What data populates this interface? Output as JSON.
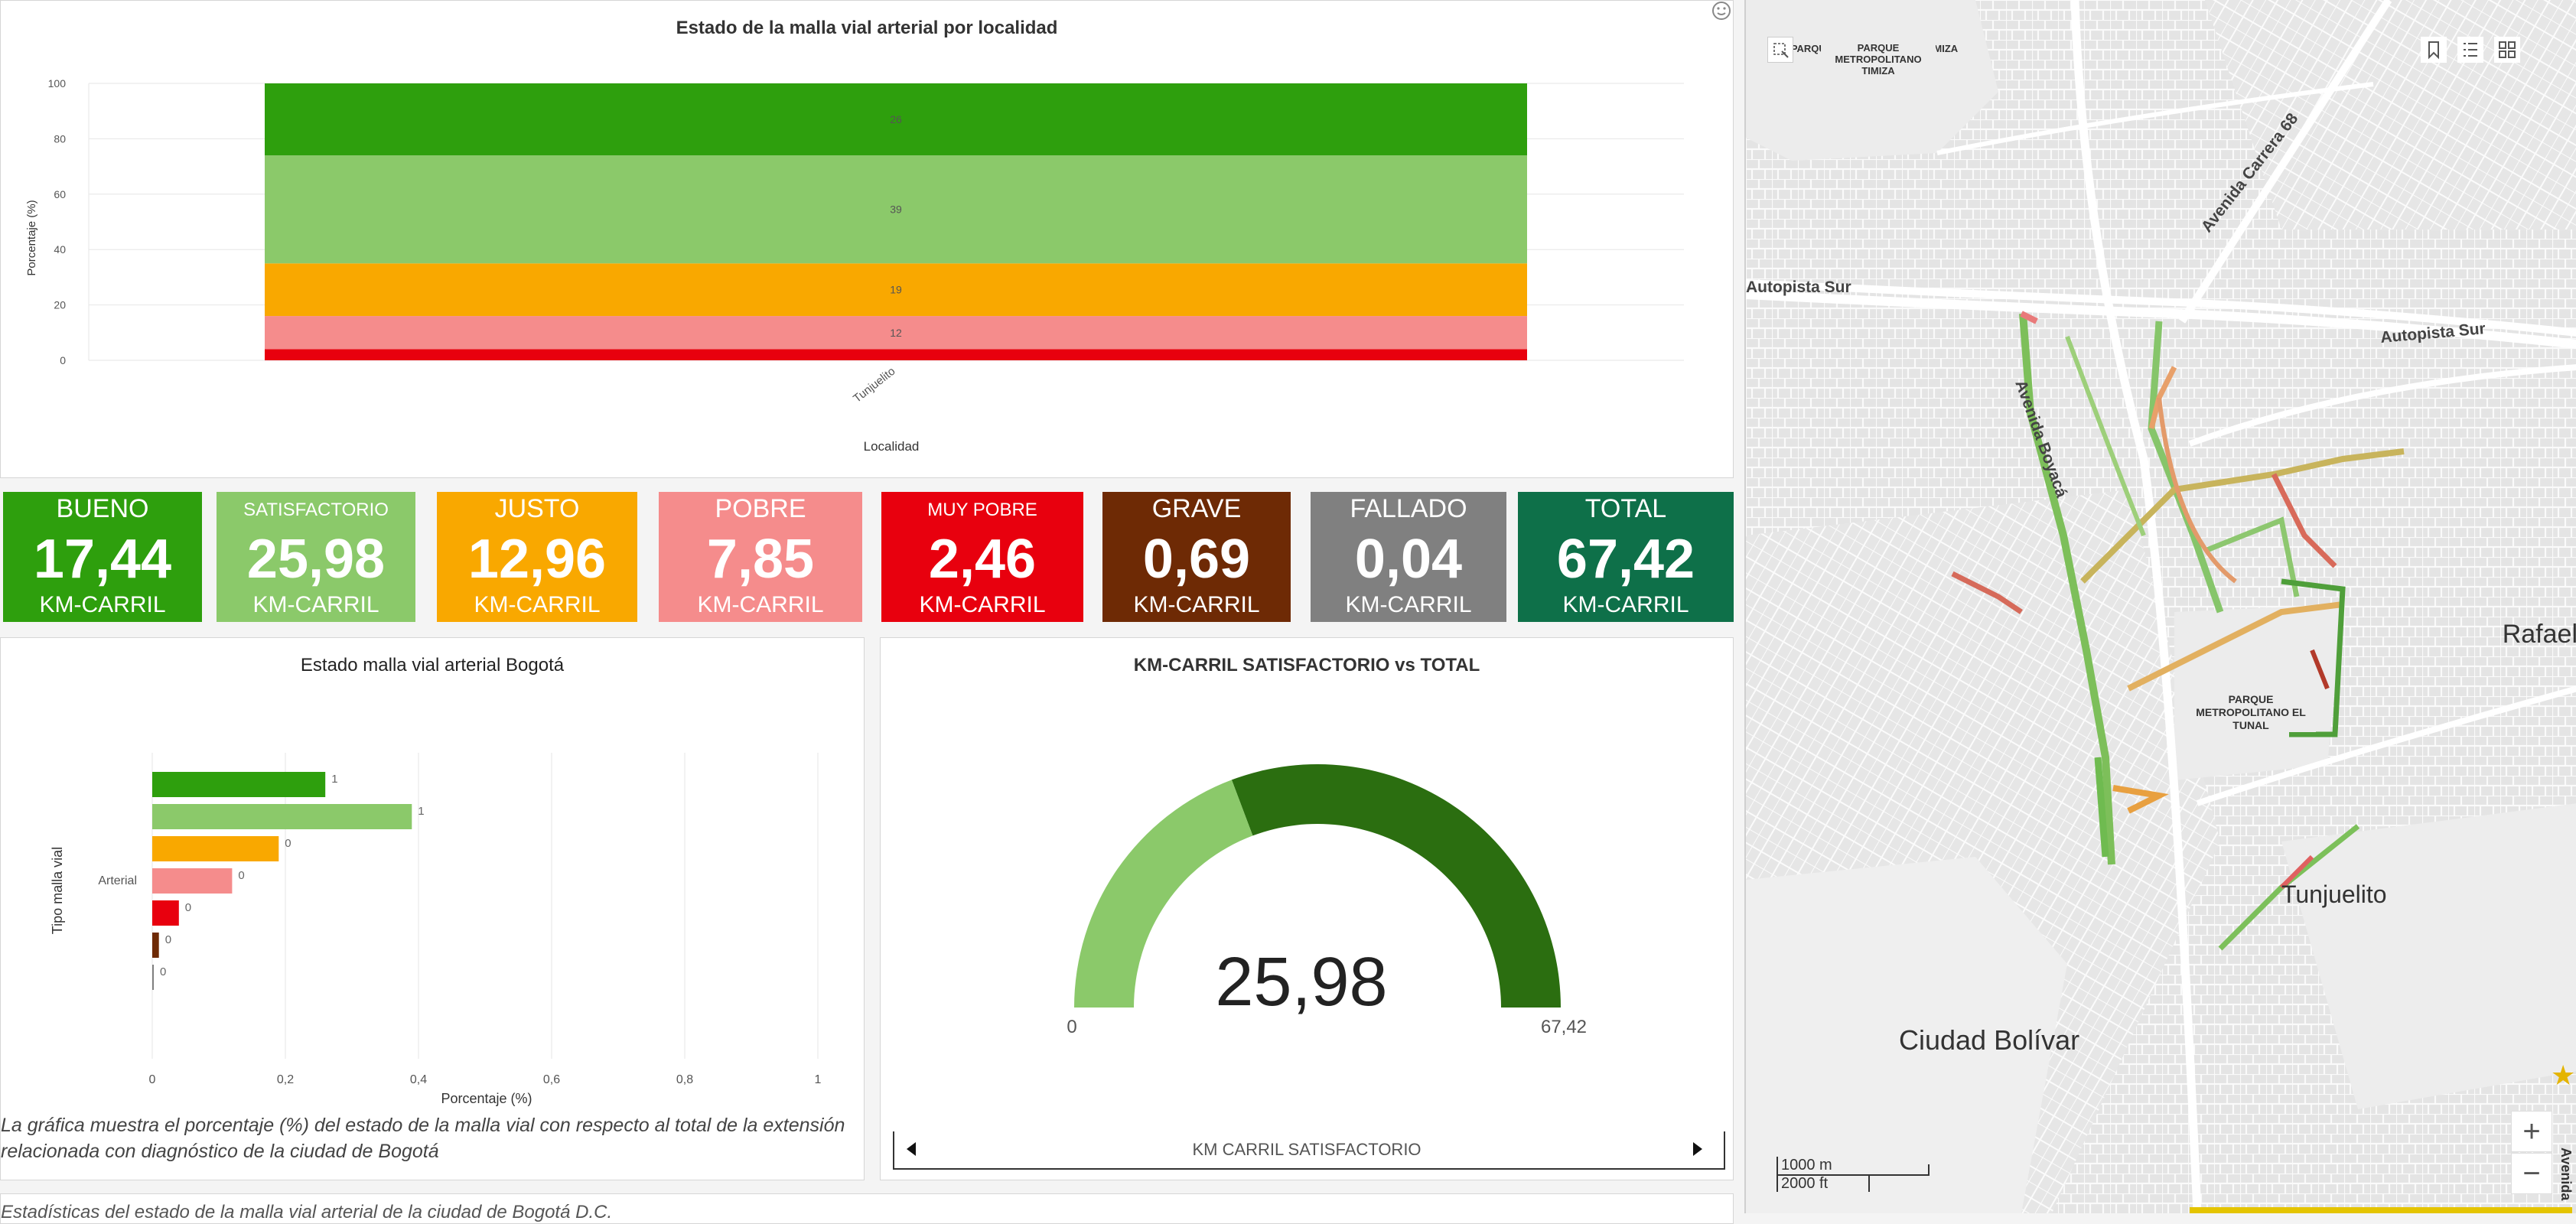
{
  "top_chart": {
    "title": "Estado de la malla vial arterial por localidad",
    "xlabel": "Localidad",
    "ylabel": "Porcentaje (%)"
  },
  "tiles": [
    {
      "label": "BUENO",
      "value": "17,44",
      "unit": "KM-CARRIL",
      "color": "#2e9f0d",
      "small": false
    },
    {
      "label": "SATISFACTORIO",
      "value": "25,98",
      "unit": "KM-CARRIL",
      "color": "#8bc96a",
      "small": true
    },
    {
      "label": "JUSTO",
      "value": "12,96",
      "unit": "KM-CARRIL",
      "color": "#f9a800",
      "small": false
    },
    {
      "label": "POBRE",
      "value": "7,85",
      "unit": "KM-CARRIL",
      "color": "#f58c8c",
      "small": false
    },
    {
      "label": "MUY POBRE",
      "value": "2,46",
      "unit": "KM-CARRIL",
      "color": "#e8000e",
      "small": true
    },
    {
      "label": "GRAVE",
      "value": "0,69",
      "unit": "KM-CARRIL",
      "color": "#6e2a05",
      "small": false
    },
    {
      "label": "FALLADO",
      "value": "0,04",
      "unit": "KM-CARRIL",
      "color": "#808080",
      "small": false
    },
    {
      "label": "TOTAL",
      "value": "67,42",
      "unit": "KM-CARRIL",
      "color": "#0e7049",
      "small": false
    }
  ],
  "bar_chart": {
    "title": "Estado malla vial arterial Bogotá",
    "xlabel": "Porcentaje (%)",
    "ylabel": "Tipo malla vial",
    "caption": "La gráfica muestra el porcentaje (%) del estado de la malla vial con respecto al total de la extensión relacionada con diagnóstico de la ciudad de Bogotá"
  },
  "gauge": {
    "title": "KM-CARRIL SATISFACTORIO vs TOTAL",
    "value_label": "25,98",
    "min_label": "0",
    "max_label": "67,42",
    "value": 25.98,
    "max": 67.42,
    "footer_label": "KM CARRIL SATISFACTORIO",
    "colors": {
      "fill": "#8bc96a",
      "rest": "#2b6e10"
    }
  },
  "bottom_text": "Estadísticas del estado de la malla vial arterial de la ciudad de Bogotá D.C.",
  "map": {
    "labels": {
      "parque_timiza": "PARQUE METROPOLITANO TIMIZA",
      "carrera68": "Avenida Carrera 68",
      "autopista_sur_w": "Autopista Sur",
      "autopista_sur_e": "Autopista Sur",
      "boyaca": "Avenida Boyacá",
      "rafael": "Rafael",
      "parque_tunal": "PARQUE METROPOLITANO EL TUNAL",
      "tunjuelito": "Tunjuelito",
      "ciudad_bolivar": "Ciudad Bolívar",
      "avenida_edge": "Avenida"
    },
    "scale": {
      "metric": "1000 m",
      "imperial": "2000 ft"
    },
    "zoom_in": "+",
    "zoom_out": "−"
  },
  "chart_data": [
    {
      "type": "bar",
      "title": "Estado de la malla vial arterial por localidad",
      "xlabel": "Localidad",
      "ylabel": "Porcentaje (%)",
      "categories": [
        "Tunjuelito"
      ],
      "stacked": true,
      "ylim": [
        0,
        100
      ],
      "yticks": [
        0,
        20,
        40,
        60,
        80,
        100
      ],
      "series": [
        {
          "values": [
            4
          ],
          "color": "#e8000e"
        },
        {
          "values": [
            12
          ],
          "color": "#f58c8c"
        },
        {
          "values": [
            19
          ],
          "color": "#f9a800"
        },
        {
          "values": [
            39
          ],
          "color": "#8bc96a"
        },
        {
          "values": [
            26
          ],
          "color": "#2e9f0d"
        }
      ],
      "segment_labels": [
        "",
        "12",
        "19",
        "39",
        "26"
      ]
    },
    {
      "type": "bar",
      "orientation": "horizontal",
      "title": "Estado malla vial arterial Bogotá",
      "xlabel": "Porcentaje (%)",
      "ylabel": "Tipo malla vial",
      "category": "Arterial",
      "xlim": [
        0,
        1
      ],
      "xticks": [
        "0",
        "0,2",
        "0,4",
        "0,6",
        "0,8",
        "1"
      ],
      "bars": [
        {
          "value": 0.26,
          "label": "1",
          "color": "#2e9f0d"
        },
        {
          "value": 0.39,
          "label": "1",
          "color": "#8bc96a"
        },
        {
          "value": 0.19,
          "label": "0",
          "color": "#f9a800"
        },
        {
          "value": 0.12,
          "label": "0",
          "color": "#f58c8c"
        },
        {
          "value": 0.04,
          "label": "0",
          "color": "#e8000e"
        },
        {
          "value": 0.01,
          "label": "0",
          "color": "#6e2a05"
        },
        {
          "value": 0.0006,
          "label": "0",
          "color": "#808080"
        }
      ]
    }
  ]
}
